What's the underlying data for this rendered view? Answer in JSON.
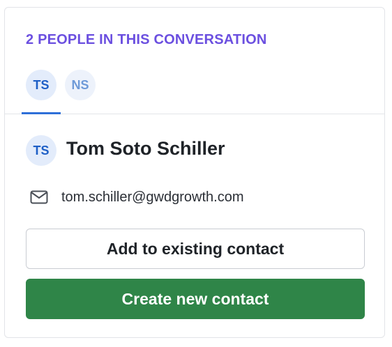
{
  "panel": {
    "heading": "2 PEOPLE IN THIS CONVERSATION"
  },
  "participants": [
    {
      "initials": "TS",
      "active": true
    },
    {
      "initials": "NS",
      "active": false
    }
  ],
  "selected_person": {
    "initials": "TS",
    "name": "Tom Soto Schiller",
    "email": "tom.schiller@gwdgrowth.com",
    "email_icon": "mail-icon"
  },
  "actions": {
    "add_existing_label": "Add to existing contact",
    "create_new_label": "Create new contact"
  },
  "colors": {
    "heading": "#6b4fe0",
    "active_tab_underline": "#2e6fd8",
    "avatar_bg": "#e3ecfb",
    "avatar_text": "#1e5fc6",
    "primary_button": "#2f8548"
  }
}
